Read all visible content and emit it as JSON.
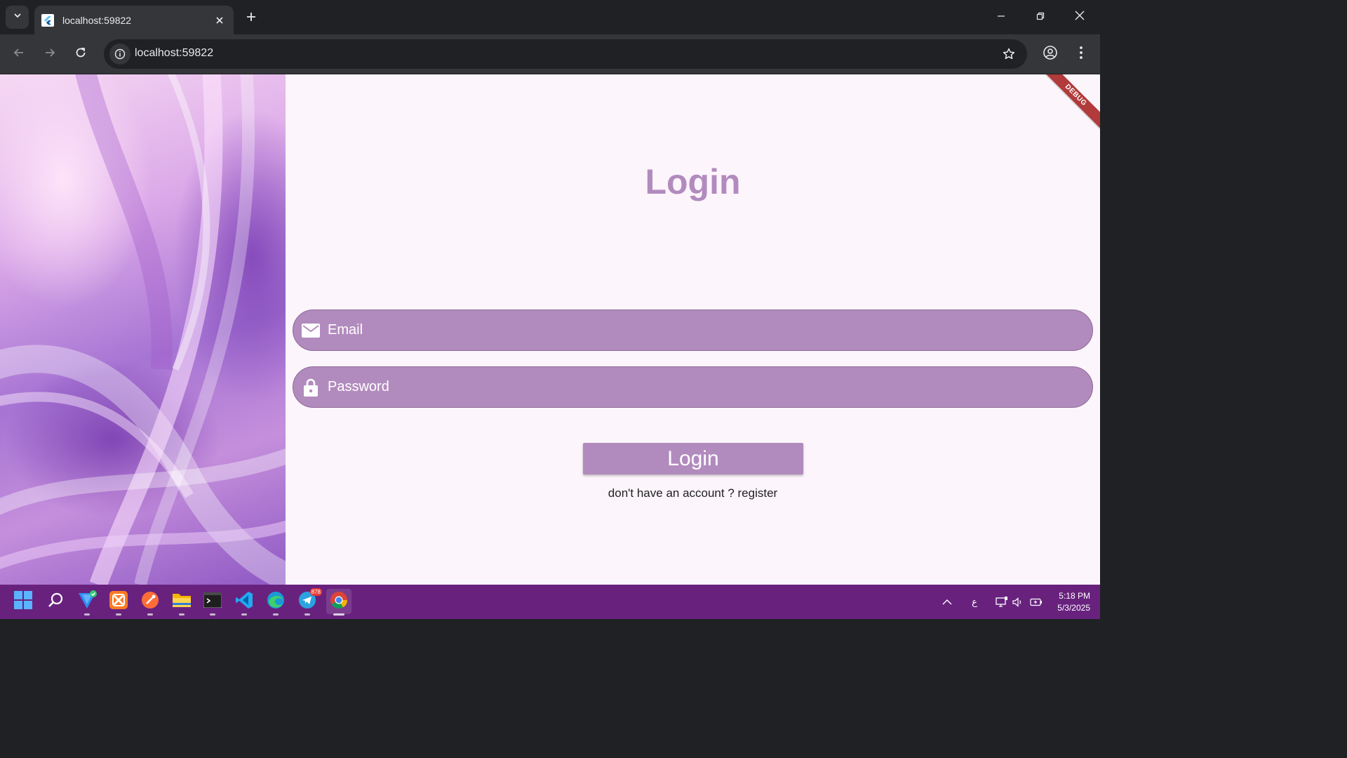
{
  "browser": {
    "tab": {
      "title": "localhost:59822"
    },
    "address_bar": {
      "url": "localhost:59822"
    }
  },
  "app": {
    "debug_banner": "DEBUG",
    "title": "Login",
    "email_field": {
      "label": "Email"
    },
    "password_field": {
      "label": "Password"
    },
    "login_button": "Login",
    "register_link": "don't have an account ? register",
    "colors": {
      "accent": "#b28bbe",
      "background": "#fdf5fc"
    }
  },
  "taskbar": {
    "apps": [
      "start-menu",
      "search",
      "vpn",
      "xampp",
      "postman",
      "file-explorer",
      "terminal",
      "vscode",
      "edge",
      "telegram",
      "chrome"
    ],
    "telegram_badge": "878",
    "tray": {
      "language": "ع"
    },
    "clock": {
      "time": "5:18 PM",
      "date": "5/3/2025"
    },
    "color": "#68227e"
  }
}
